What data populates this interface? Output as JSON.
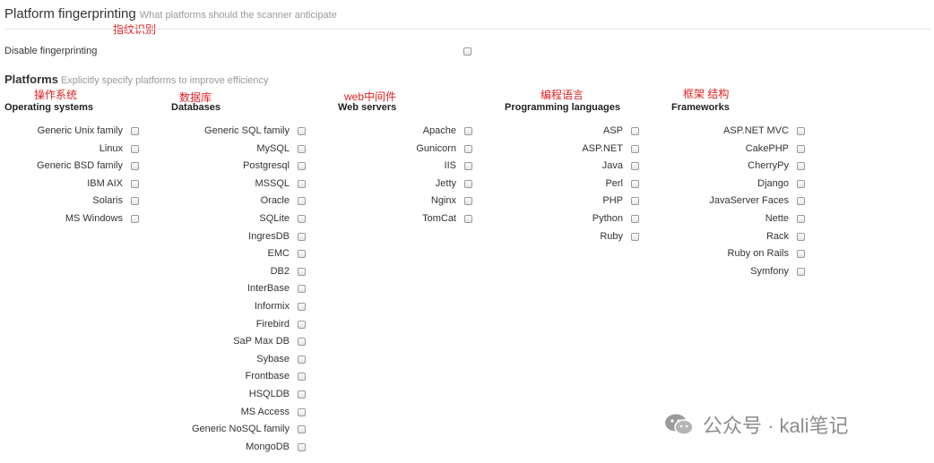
{
  "header": {
    "title": "Platform fingerprinting",
    "subtitle": "What platforms should the scanner anticipate",
    "annotation": "指纹识别"
  },
  "disable": {
    "label": "Disable fingerprinting"
  },
  "platforms": {
    "title": "Platforms",
    "subtitle": "Explicitly specify platforms to improve efficiency"
  },
  "columns": [
    {
      "annotation": "操作系统",
      "heading": "Operating systems",
      "items": [
        "Generic Unix family",
        "Linux",
        "Generic BSD family",
        "IBM AIX",
        "Solaris",
        "MS Windows"
      ]
    },
    {
      "annotation": "数据库",
      "heading": "Databases",
      "items": [
        "Generic SQL family",
        "MySQL",
        "Postgresql",
        "MSSQL",
        "Oracle",
        "SQLite",
        "IngresDB",
        "EMC",
        "DB2",
        "InterBase",
        "Informix",
        "Firebird",
        "SaP Max DB",
        "Sybase",
        "Frontbase",
        "HSQLDB",
        "MS Access",
        "Generic NoSQL family",
        "MongoDB"
      ]
    },
    {
      "annotation": "web中间件",
      "heading": "Web servers",
      "items": [
        "Apache",
        "Gunicorn",
        "IIS",
        "Jetty",
        "Nginx",
        "TomCat"
      ]
    },
    {
      "annotation": "编程语言",
      "heading": "Programming languages",
      "items": [
        "ASP",
        "ASP.NET",
        "Java",
        "Perl",
        "PHP",
        "Python",
        "Ruby"
      ]
    },
    {
      "annotation": "框架 结构",
      "heading": "Frameworks",
      "items": [
        "ASP.NET MVC",
        "CakePHP",
        "CherryPy",
        "Django",
        "JavaServer Faces",
        "Nette",
        "Rack",
        "Ruby on Rails",
        "Symfony"
      ]
    }
  ],
  "watermark": {
    "text": "公众号 · kali笔记",
    "icon": "wechat-icon"
  }
}
